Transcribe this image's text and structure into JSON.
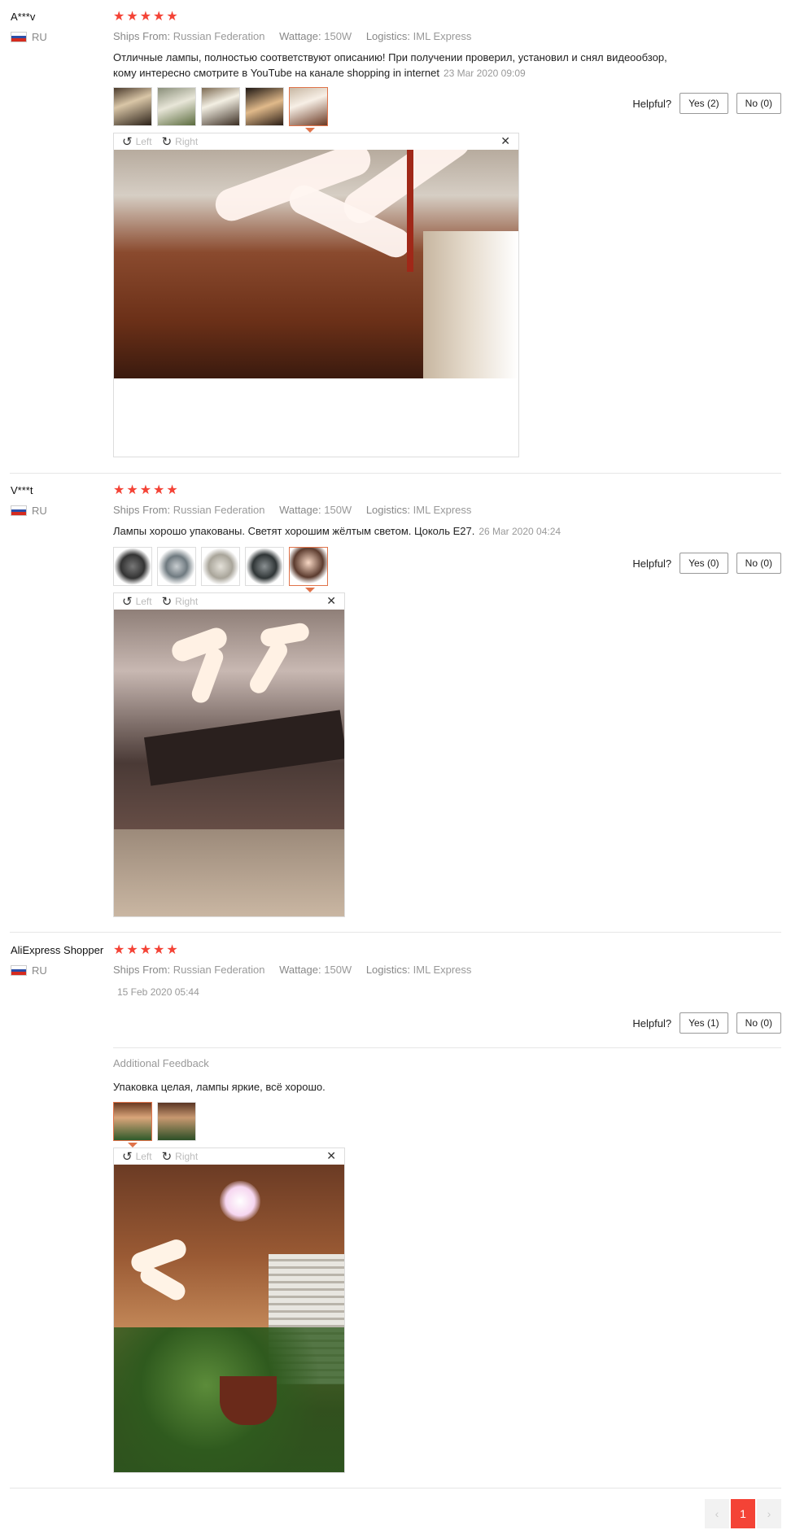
{
  "reviews": [
    {
      "user": "A***v",
      "country": "RU",
      "rating": 5,
      "ships_from_label": "Ships From:",
      "ships_from": "Russian Federation",
      "wattage_label": "Wattage:",
      "wattage": "150W",
      "logistics_label": "Logistics:",
      "logistics": "IML Express",
      "text_line1": "Отличные лампы, полностью соответствуют описанию! При получении проверил, установил и снял видеообзор,",
      "text_line2": "кому интересно смотрите в YouTube на канале shopping in internet",
      "date": "23 Mar 2020 09:09",
      "helpful_label": "Helpful?",
      "yes": "Yes (2)",
      "no": "No (0)",
      "viewer_left": "Left",
      "viewer_right": "Right"
    },
    {
      "user": "V***t",
      "country": "RU",
      "rating": 5,
      "ships_from_label": "Ships From:",
      "ships_from": "Russian Federation",
      "wattage_label": "Wattage:",
      "wattage": "150W",
      "logistics_label": "Logistics:",
      "logistics": "IML Express",
      "text_line1": "Лампы хорошо упакованы. Светят хорошим жёлтым светом. Цоколь Е27.",
      "date": "26 Mar 2020 04:24",
      "helpful_label": "Helpful?",
      "yes": "Yes (0)",
      "no": "No (0)",
      "viewer_left": "Left",
      "viewer_right": "Right"
    },
    {
      "user": "AliExpress Shopper",
      "country": "RU",
      "rating": 5,
      "ships_from_label": "Ships From:",
      "ships_from": "Russian Federation",
      "wattage_label": "Wattage:",
      "wattage": "150W",
      "logistics_label": "Logistics:",
      "logistics": "IML Express",
      "date": "15 Feb 2020 05:44",
      "helpful_label": "Helpful?",
      "yes": "Yes (1)",
      "no": "No (0)",
      "additional_feedback_label": "Additional Feedback",
      "additional_text": "Упаковка целая, лампы яркие, всё хорошо.",
      "viewer_left": "Left",
      "viewer_right": "Right"
    }
  ],
  "pagination": {
    "prev": "‹",
    "current": "1",
    "next": "›"
  },
  "colors": {
    "star": "#f44336",
    "active_thumb": "#e0734a",
    "page_current": "#f44336"
  },
  "icons": [
    "rotate-left-icon",
    "rotate-right-icon",
    "close-icon",
    "star-icon",
    "flag-ru-icon"
  ]
}
